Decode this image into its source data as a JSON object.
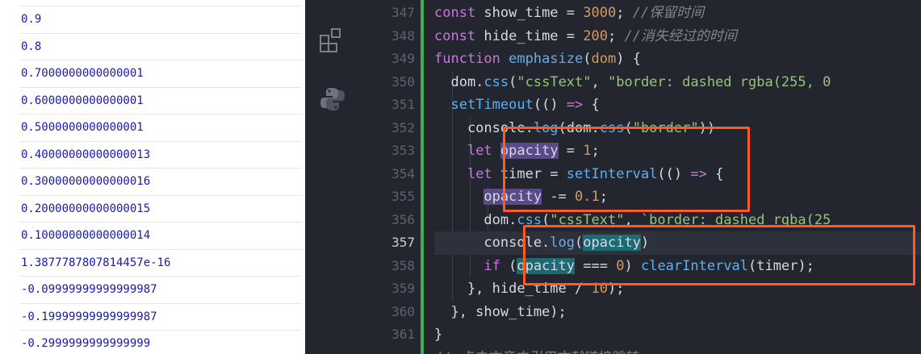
{
  "console": {
    "values": [
      "0.9",
      "0.8",
      "0.7000000000000001",
      "0.6000000000000001",
      "0.5000000000000001",
      "0.40000000000000013",
      "0.30000000000000016",
      "0.20000000000000015",
      "0.10000000000000014",
      "1.3877787807814457e-16",
      "-0.09999999999999987",
      "-0.19999999999999987",
      "-0.2999999999999999"
    ]
  },
  "editor": {
    "active_line": "357",
    "line_numbers": [
      "347",
      "348",
      "349",
      "350",
      "351",
      "352",
      "353",
      "354",
      "355",
      "356",
      "357",
      "358",
      "359",
      "360",
      "361"
    ],
    "lines": [
      {
        "no": "347",
        "segments": [
          [
            "k",
            "const "
          ],
          [
            "p",
            "show_time = "
          ],
          [
            "n",
            "3000"
          ],
          [
            "p",
            "; "
          ],
          [
            "c",
            "//保留时间"
          ]
        ]
      },
      {
        "no": "348",
        "segments": [
          [
            "k",
            "const "
          ],
          [
            "p",
            "hide_time = "
          ],
          [
            "n",
            "200"
          ],
          [
            "p",
            "; "
          ],
          [
            "c",
            "//消失经过的时间"
          ]
        ]
      },
      {
        "no": "349",
        "segments": [
          [
            "k",
            "function "
          ],
          [
            "f",
            "emphasize"
          ],
          [
            "p",
            "("
          ],
          [
            "n",
            "dom"
          ],
          [
            "p",
            ") {"
          ]
        ]
      },
      {
        "no": "350",
        "segments": [
          [
            "p",
            "  dom."
          ],
          [
            "f",
            "css"
          ],
          [
            "p",
            "("
          ],
          [
            "s",
            "\"cssText\""
          ],
          [
            "p",
            ", "
          ],
          [
            "s",
            "\"border: dashed rgba(255, 0"
          ]
        ]
      },
      {
        "no": "351",
        "segments": [
          [
            "p",
            "  "
          ],
          [
            "f",
            "setTimeout"
          ],
          [
            "p",
            "(() "
          ],
          [
            "k",
            "=>"
          ],
          [
            "p",
            " {"
          ]
        ]
      },
      {
        "no": "352",
        "segments": [
          [
            "p",
            "    console."
          ],
          [
            "f",
            "log"
          ],
          [
            "p",
            "(dom."
          ],
          [
            "f",
            "css"
          ],
          [
            "p",
            "("
          ],
          [
            "s",
            "\"border\""
          ],
          [
            "p",
            "))"
          ]
        ]
      },
      {
        "no": "353",
        "segments": [
          [
            "p",
            "    "
          ],
          [
            "k",
            "let "
          ],
          [
            "hl",
            "opacity"
          ],
          [
            "p",
            " = "
          ],
          [
            "n",
            "1"
          ],
          [
            "p",
            ";"
          ]
        ]
      },
      {
        "no": "354",
        "segments": [
          [
            "p",
            "    "
          ],
          [
            "k",
            "let "
          ],
          [
            "p",
            "timer = "
          ],
          [
            "f",
            "setInterval"
          ],
          [
            "p",
            "(() "
          ],
          [
            "k",
            "=>"
          ],
          [
            "p",
            " {"
          ]
        ]
      },
      {
        "no": "355",
        "segments": [
          [
            "p",
            "      "
          ],
          [
            "hl",
            "opacity"
          ],
          [
            "p",
            " -= "
          ],
          [
            "n",
            "0.1"
          ],
          [
            "p",
            ";"
          ]
        ]
      },
      {
        "no": "356",
        "segments": [
          [
            "p",
            "      dom."
          ],
          [
            "f",
            "css"
          ],
          [
            "p",
            "("
          ],
          [
            "s",
            "\"cssText\""
          ],
          [
            "p",
            ", "
          ],
          [
            "s",
            "`border: dashed rgba(25"
          ]
        ]
      },
      {
        "no": "357",
        "segments": [
          [
            "p",
            "      console."
          ],
          [
            "f",
            "log"
          ],
          [
            "p",
            "("
          ],
          [
            "hl2",
            "opacity"
          ],
          [
            "p",
            ")"
          ]
        ]
      },
      {
        "no": "358",
        "segments": [
          [
            "p",
            "      "
          ],
          [
            "k",
            "if "
          ],
          [
            "p",
            "("
          ],
          [
            "hl2",
            "opacity"
          ],
          [
            "p",
            " === "
          ],
          [
            "n",
            "0"
          ],
          [
            "p",
            ") "
          ],
          [
            "f",
            "clearInterval"
          ],
          [
            "p",
            "(timer);"
          ]
        ]
      },
      {
        "no": "359",
        "segments": [
          [
            "p",
            "    }, hide_time / "
          ],
          [
            "n",
            "10"
          ],
          [
            "p",
            ");"
          ]
        ]
      },
      {
        "no": "360",
        "segments": [
          [
            "p",
            "  }, show_time);"
          ]
        ]
      },
      {
        "no": "361",
        "segments": [
          [
            "p",
            "}"
          ]
        ]
      }
    ],
    "bottom_partial": "// 点击文章内引用文献链接跳转"
  },
  "colors": {
    "highlight_box": "#ff5a1f",
    "git_added": "#3eae4f",
    "console_text": "#1a1aa6"
  },
  "icons": [
    "extensions-icon",
    "python-icon"
  ]
}
